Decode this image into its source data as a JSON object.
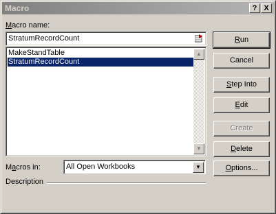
{
  "window": {
    "title": "Macro",
    "help_button": "?",
    "close_button": "X"
  },
  "macro_name": {
    "label_accel": "M",
    "label_rest": "acro name:",
    "value": "StratumRecordCount"
  },
  "macro_list": {
    "items": [
      "MakeStandTable",
      "StratumRecordCount"
    ],
    "selected_index": 1
  },
  "macros_in": {
    "label_pre": "M",
    "label_accel": "a",
    "label_rest": "cros in:",
    "value": "All Open Workbooks"
  },
  "description": {
    "label": "Description"
  },
  "buttons": {
    "run": {
      "accel": "R",
      "rest": "un"
    },
    "cancel": {
      "label": "Cancel"
    },
    "step_into": {
      "accel": "S",
      "rest": "tep Into"
    },
    "edit": {
      "accel": "E",
      "rest": "dit"
    },
    "create": {
      "label": "Create"
    },
    "delete": {
      "accel": "D",
      "rest": "elete"
    },
    "options": {
      "accel": "O",
      "rest": "ptions..."
    }
  }
}
